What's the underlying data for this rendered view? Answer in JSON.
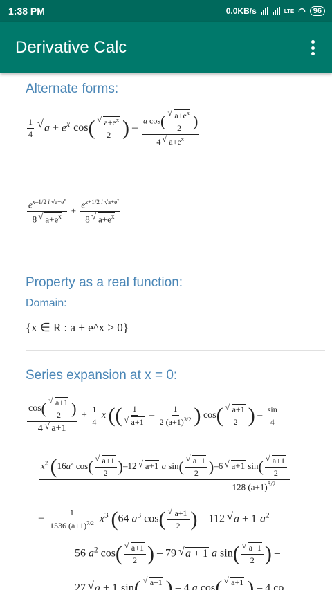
{
  "status": {
    "time": "1:38 PM",
    "net": "0.0KB/s",
    "lte": "LTE",
    "battery": "96"
  },
  "app": {
    "title": "Derivative Calc"
  },
  "sections": {
    "alternate": "Alternate forms:",
    "property": "Property as a real function:",
    "domain_label": "Domain:",
    "domain_value": "{x ∈ R : a + e^x > 0}",
    "series": "Series expansion at x = 0:"
  },
  "colors": {
    "appbar": "#00796b",
    "statusbar": "#00695c",
    "heading": "#4a86b6"
  }
}
